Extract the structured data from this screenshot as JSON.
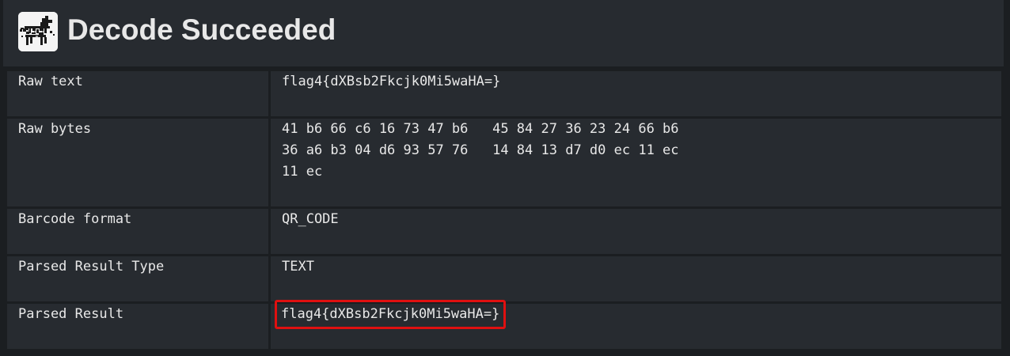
{
  "header": {
    "title": "Decode Succeeded",
    "logo_icon": "barcode-dog-logo-icon"
  },
  "rows": [
    {
      "label": "Raw text",
      "value": "flag4{dXBsb2Fkcjk0Mi5waHA=}"
    },
    {
      "label": "Raw bytes",
      "value_lines": [
        "41 b6 66 c6 16 73 47 b6   45 84 27 36 23 24 66 b6",
        "36 a6 b3 04 d6 93 57 76   14 84 13 d7 d0 ec 11 ec",
        "11 ec"
      ]
    },
    {
      "label": "Barcode format",
      "value": "QR_CODE"
    },
    {
      "label": "Parsed Result Type",
      "value": "TEXT"
    },
    {
      "label": "Parsed Result",
      "value": "flag4{dXBsb2Fkcjk0Mi5waHA=}"
    }
  ],
  "colors": {
    "background": "#1b1e21",
    "panel": "#272b30",
    "text": "#e8e8e8",
    "highlight_border": "#e01010"
  }
}
